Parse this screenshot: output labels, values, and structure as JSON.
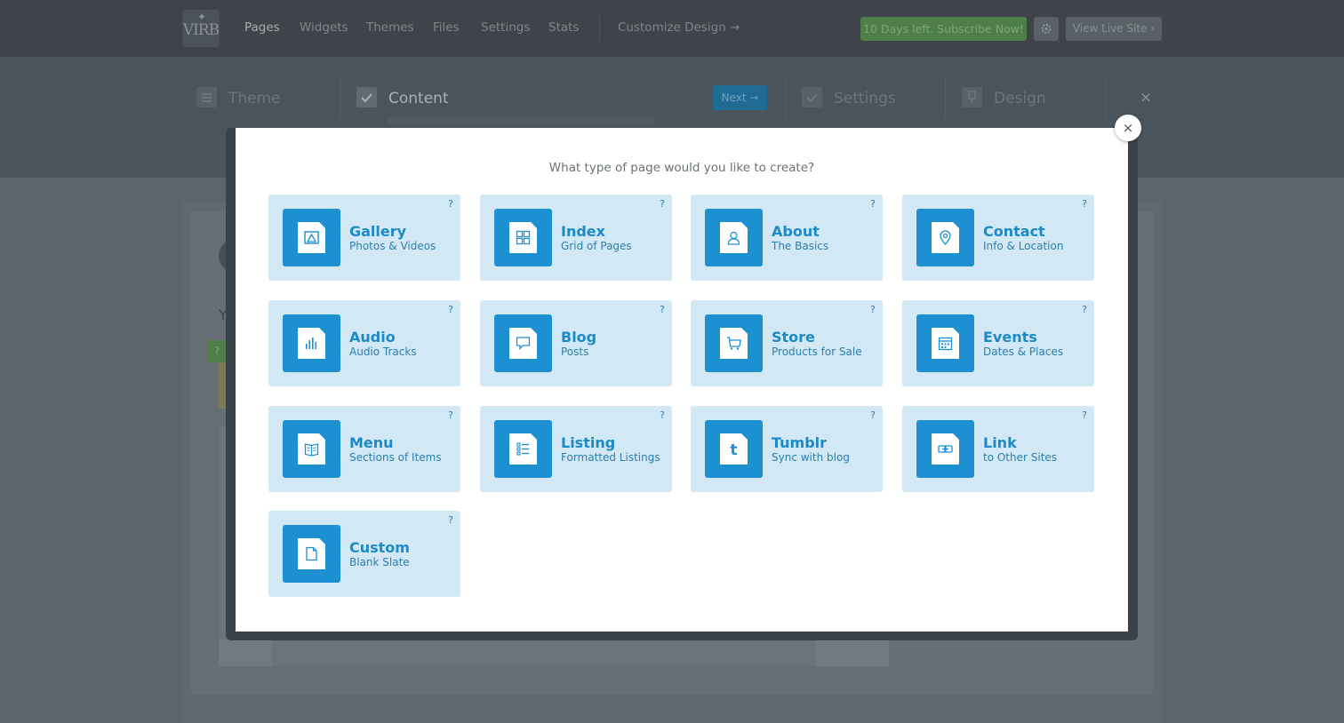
{
  "nav": {
    "logo": "VIRB",
    "items": [
      "Pages",
      "Widgets",
      "Themes",
      "Files",
      "Settings",
      "Stats"
    ],
    "customize": "Customize Design →",
    "subscribe": "10 Days left. Subscribe Now!",
    "view_live": "View Live Site ›"
  },
  "steps": {
    "theme": "Theme",
    "content": "Content",
    "next": "Next →",
    "settings": "Settings",
    "design": "Design",
    "close": "×"
  },
  "background": {
    "y_text": "Y",
    "help_badge": "?"
  },
  "modal": {
    "title": "What type of page would you like to create?",
    "close": "×",
    "help": "?",
    "tiles": [
      {
        "title": "Gallery",
        "subtitle": "Photos & Videos",
        "icon": "gallery-icon"
      },
      {
        "title": "Index",
        "subtitle": "Grid of Pages",
        "icon": "grid-icon"
      },
      {
        "title": "About",
        "subtitle": "The Basics",
        "icon": "person-icon"
      },
      {
        "title": "Contact",
        "subtitle": "Info & Location",
        "icon": "location-pin-icon"
      },
      {
        "title": "Audio",
        "subtitle": "Audio Tracks",
        "icon": "audio-bars-icon"
      },
      {
        "title": "Blog",
        "subtitle": "Posts",
        "icon": "speech-bubble-icon"
      },
      {
        "title": "Store",
        "subtitle": "Products for Sale",
        "icon": "cart-icon"
      },
      {
        "title": "Events",
        "subtitle": "Dates & Places",
        "icon": "calendar-icon"
      },
      {
        "title": "Menu",
        "subtitle": "Sections of Items",
        "icon": "book-icon"
      },
      {
        "title": "Listing",
        "subtitle": "Formatted Listings",
        "icon": "list-icon"
      },
      {
        "title": "Tumblr",
        "subtitle": "Sync with blog",
        "icon": "tumblr-icon"
      },
      {
        "title": "Link",
        "subtitle": "to Other Sites",
        "icon": "link-icon"
      },
      {
        "title": "Custom",
        "subtitle": "Blank Slate",
        "icon": "blank-page-icon"
      }
    ]
  },
  "colors": {
    "accent": "#1d90d2",
    "tile_bg": "#d3e8f5",
    "tile_text": "#1d8ac8"
  }
}
